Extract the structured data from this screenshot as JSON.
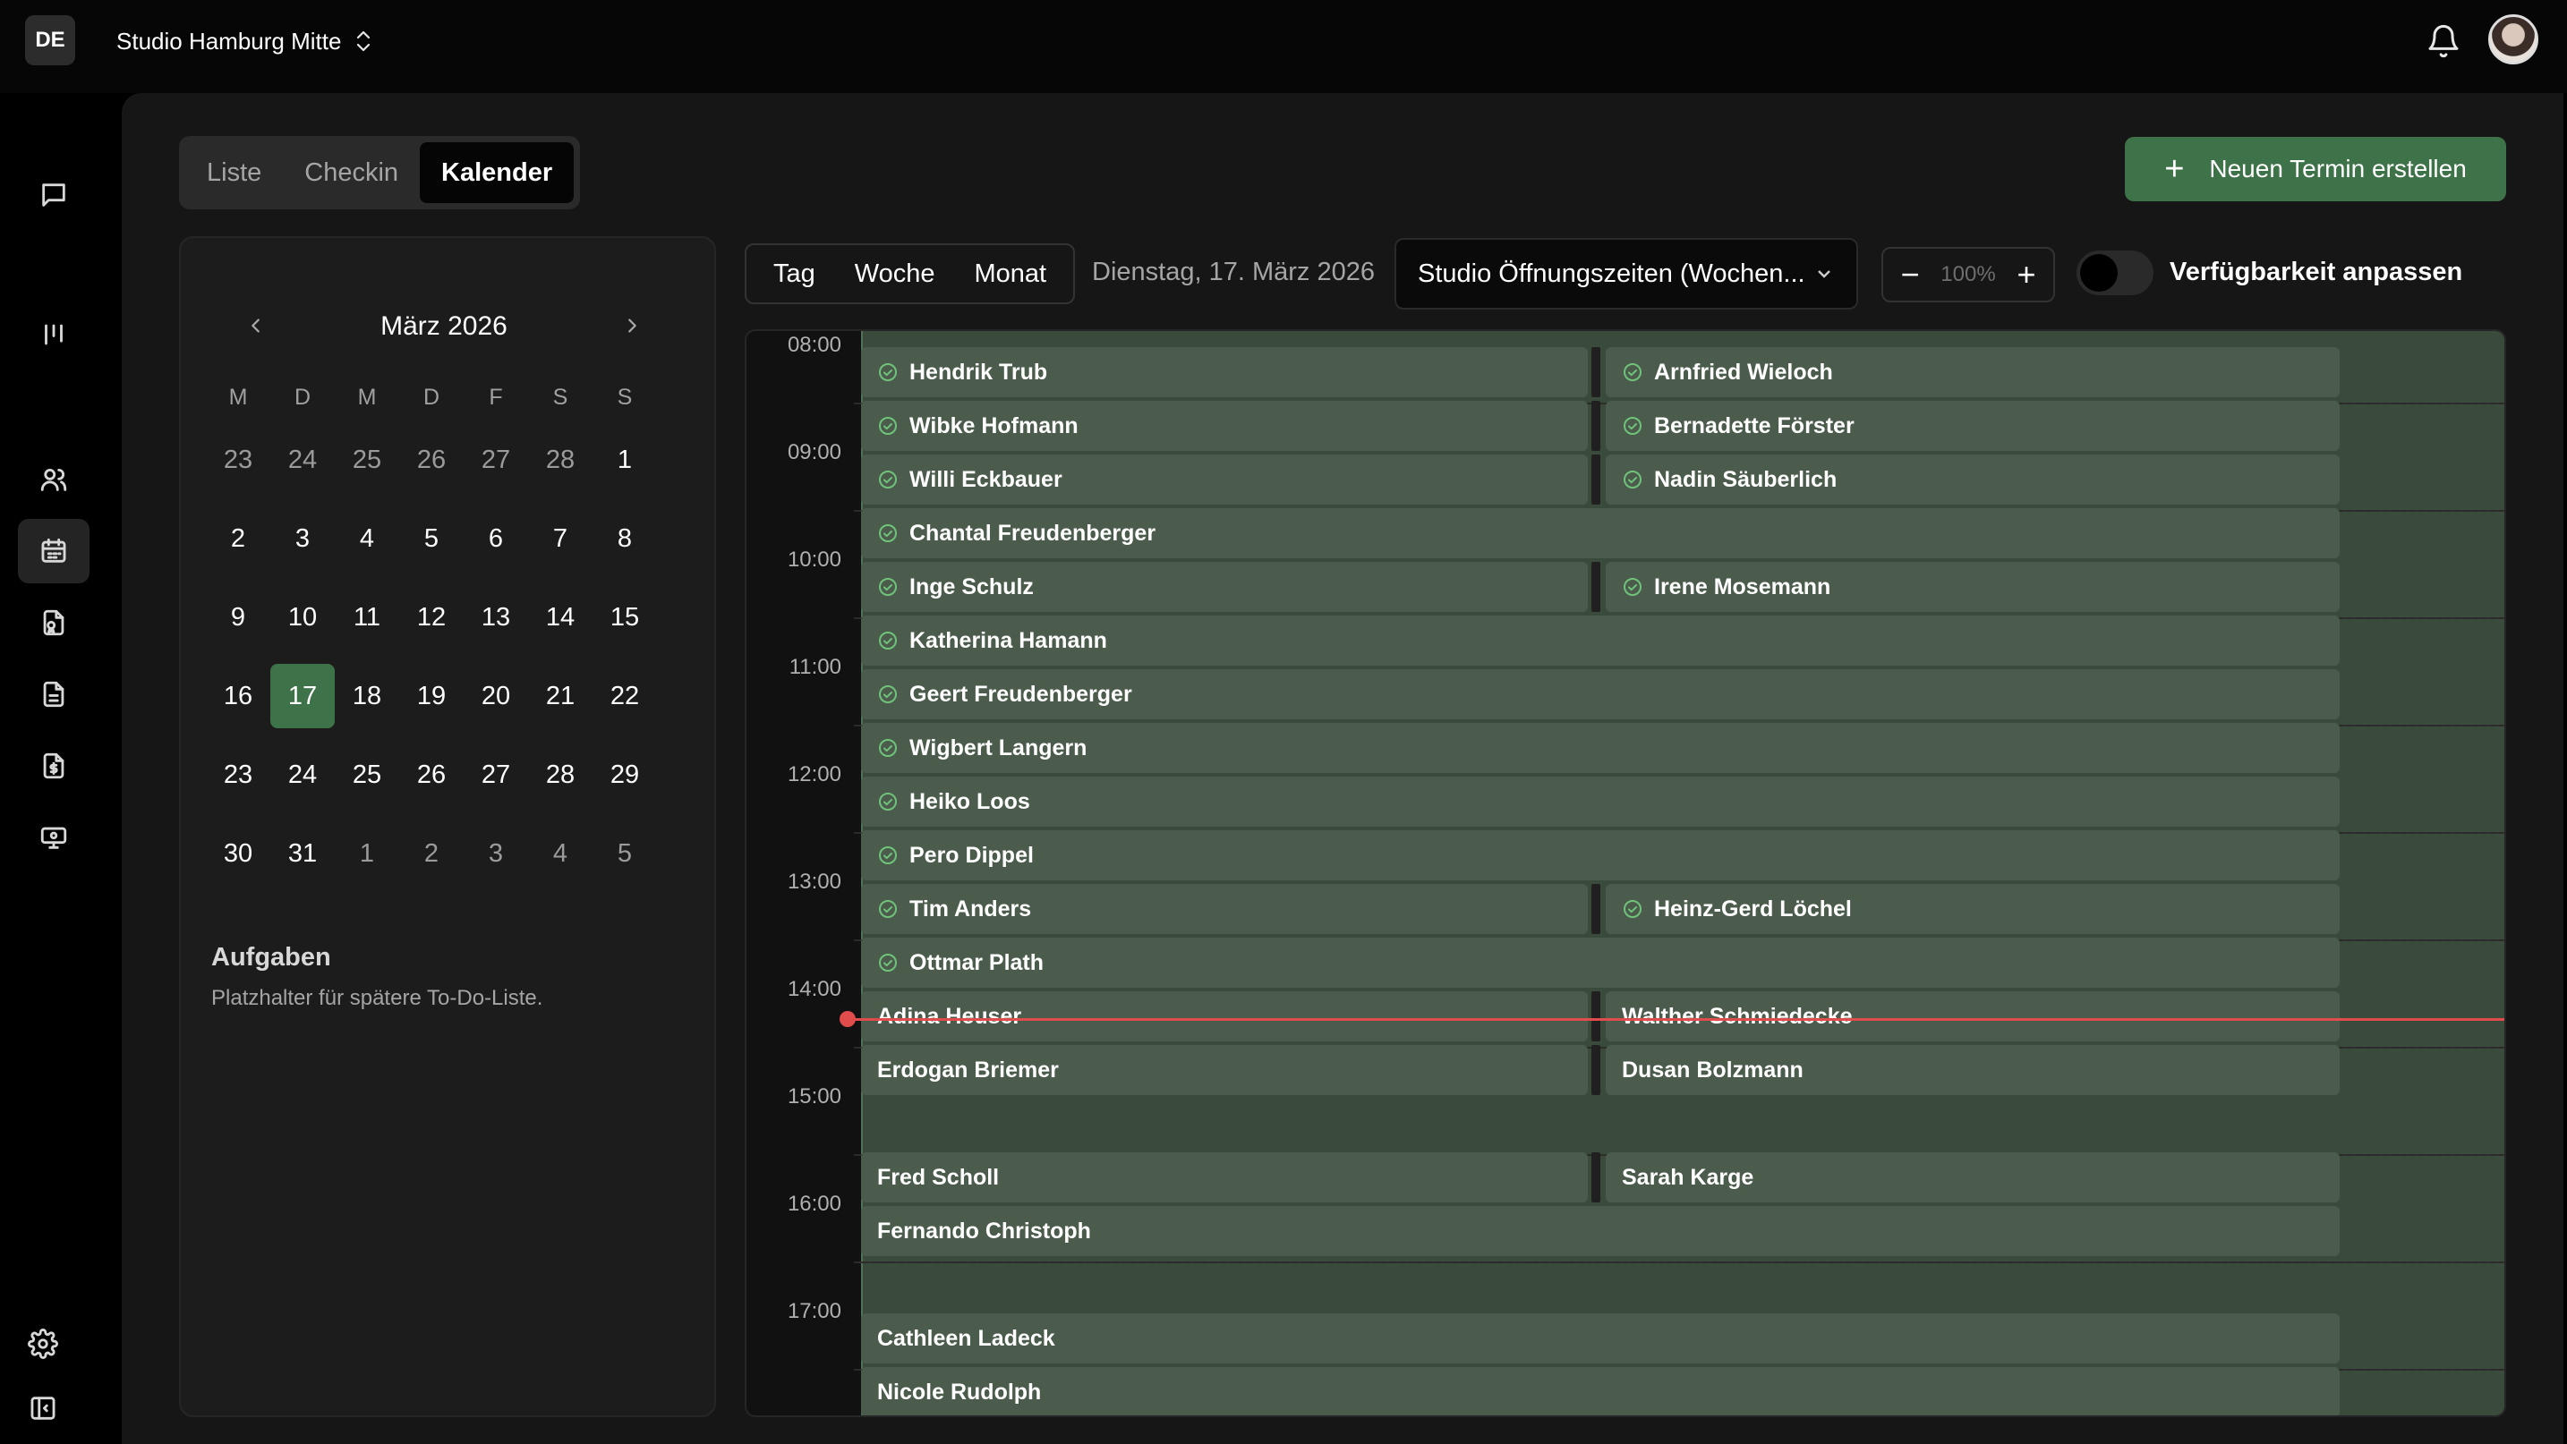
{
  "topbar": {
    "badge": "DE",
    "studio": "Studio Hamburg Mitte"
  },
  "sidebar": {
    "icons": [
      "chat-icon",
      "columns-icon",
      "users-icon",
      "calendar-icon",
      "contract-icon",
      "document-icon",
      "invoice-icon",
      "cash-register-icon",
      "settings-icon",
      "collapse-sidebar-icon"
    ]
  },
  "views": [
    "Liste",
    "Checkin",
    "Kalender"
  ],
  "new_button": "Neuen Termin erstellen",
  "minical": {
    "month": "März 2026",
    "weekdays": [
      "M",
      "D",
      "M",
      "D",
      "F",
      "S",
      "S"
    ],
    "days": [
      {
        "n": "23",
        "m": true
      },
      {
        "n": "24",
        "m": true
      },
      {
        "n": "25",
        "m": true
      },
      {
        "n": "26",
        "m": true
      },
      {
        "n": "27",
        "m": true
      },
      {
        "n": "28",
        "m": true
      },
      {
        "n": "1"
      },
      {
        "n": "2"
      },
      {
        "n": "3"
      },
      {
        "n": "4"
      },
      {
        "n": "5"
      },
      {
        "n": "6"
      },
      {
        "n": "7"
      },
      {
        "n": "8"
      },
      {
        "n": "9"
      },
      {
        "n": "10"
      },
      {
        "n": "11"
      },
      {
        "n": "12"
      },
      {
        "n": "13"
      },
      {
        "n": "14"
      },
      {
        "n": "15"
      },
      {
        "n": "16"
      },
      {
        "n": "17",
        "sel": true
      },
      {
        "n": "18"
      },
      {
        "n": "19"
      },
      {
        "n": "20"
      },
      {
        "n": "21"
      },
      {
        "n": "22"
      },
      {
        "n": "23"
      },
      {
        "n": "24"
      },
      {
        "n": "25"
      },
      {
        "n": "26"
      },
      {
        "n": "27"
      },
      {
        "n": "28"
      },
      {
        "n": "29"
      },
      {
        "n": "30"
      },
      {
        "n": "31"
      },
      {
        "n": "1",
        "m": true
      },
      {
        "n": "2",
        "m": true
      },
      {
        "n": "3",
        "m": true
      },
      {
        "n": "4",
        "m": true
      },
      {
        "n": "5",
        "m": true
      }
    ]
  },
  "tasks": {
    "title": "Aufgaben",
    "subtitle": "Platzhalter für spätere To-Do-Liste."
  },
  "toolbar": {
    "ranges": [
      "Tag",
      "Woche",
      "Monat"
    ],
    "date": "Dienstag, 17. März 2026",
    "select": "Studio Öffnungszeiten (Wochen...",
    "zoom": "100%",
    "toggle_label": "Verfügbarkeit anpassen"
  },
  "schedule": {
    "times": [
      "08:00",
      "09:00",
      "10:00",
      "11:00",
      "12:00",
      "13:00",
      "14:00",
      "15:00",
      "16:00",
      "17:00"
    ],
    "now": "14:15",
    "appointments": [
      {
        "name": "Hendrik Trub",
        "start": "08:00",
        "col": 0,
        "checked": true
      },
      {
        "name": "Arnfried Wieloch",
        "start": "08:00",
        "col": 1,
        "checked": true
      },
      {
        "name": "Wibke Hofmann",
        "start": "08:30",
        "col": 0,
        "checked": true
      },
      {
        "name": "Bernadette Förster",
        "start": "08:30",
        "col": 1,
        "checked": true
      },
      {
        "name": "Willi Eckbauer",
        "start": "09:00",
        "col": 0,
        "checked": true
      },
      {
        "name": "Nadin Säuberlich",
        "start": "09:00",
        "col": 1,
        "checked": true
      },
      {
        "name": "Chantal Freudenberger",
        "start": "09:30",
        "col": -1,
        "checked": true
      },
      {
        "name": "Inge Schulz",
        "start": "10:00",
        "col": 0,
        "checked": true
      },
      {
        "name": "Irene Mosemann",
        "start": "10:00",
        "col": 1,
        "checked": true
      },
      {
        "name": "Katherina Hamann",
        "start": "10:30",
        "col": -1,
        "checked": true
      },
      {
        "name": "Geert Freudenberger",
        "start": "11:00",
        "col": -1,
        "checked": true
      },
      {
        "name": "Wigbert Langern",
        "start": "11:30",
        "col": -1,
        "checked": true
      },
      {
        "name": "Heiko Loos",
        "start": "12:00",
        "col": -1,
        "checked": true
      },
      {
        "name": "Pero Dippel",
        "start": "12:30",
        "col": -1,
        "checked": true
      },
      {
        "name": "Tim Anders",
        "start": "13:00",
        "col": 0,
        "checked": true
      },
      {
        "name": "Heinz-Gerd Löchel",
        "start": "13:00",
        "col": 1,
        "checked": true
      },
      {
        "name": "Ottmar Plath",
        "start": "13:30",
        "col": -1,
        "checked": true
      },
      {
        "name": "Adina Heuser",
        "start": "14:00",
        "col": 0,
        "checked": false
      },
      {
        "name": "Walther Schmiedecke",
        "start": "14:00",
        "col": 1,
        "checked": false
      },
      {
        "name": "Erdogan Briemer",
        "start": "14:30",
        "col": 0,
        "checked": false
      },
      {
        "name": "Dusan Bolzmann",
        "start": "14:30",
        "col": 1,
        "checked": false
      },
      {
        "name": "Fred Scholl",
        "start": "15:30",
        "col": 0,
        "checked": false
      },
      {
        "name": "Sarah Karge",
        "start": "15:30",
        "col": 1,
        "checked": false
      },
      {
        "name": "Fernando Christoph",
        "start": "16:00",
        "col": -1,
        "checked": false
      },
      {
        "name": "Cathleen Ladeck",
        "start": "17:00",
        "col": -1,
        "checked": false
      },
      {
        "name": "Nicole Rudolph",
        "start": "17:30",
        "col": -1,
        "checked": false
      }
    ]
  },
  "colors": {
    "accent": "#3e7248",
    "now": "#e04c4c",
    "check": "#6fc27a"
  }
}
